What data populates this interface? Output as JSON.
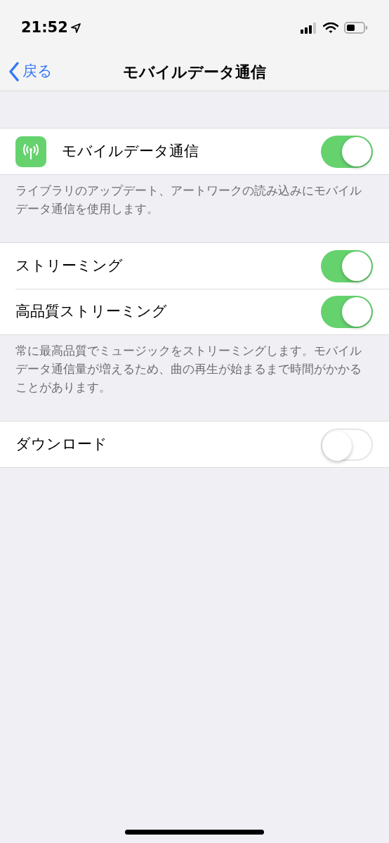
{
  "status_bar": {
    "time": "21:52"
  },
  "nav": {
    "back": "戻る",
    "title": "モバイルデータ通信"
  },
  "groups": [
    {
      "rows": [
        {
          "kind": "icon-toggle",
          "label": "モバイルデータ通信",
          "on": true
        }
      ],
      "footer": "ライブラリのアップデート、アートワークの読み込みにモバイルデータ通信を使用します。"
    },
    {
      "rows": [
        {
          "kind": "toggle",
          "label": "ストリーミング",
          "on": true
        },
        {
          "kind": "toggle",
          "label": "高品質ストリーミング",
          "on": true
        }
      ],
      "footer": "常に最高品質でミュージックをストリーミングします。モバイルデータ通信量が増えるため、曲の再生が始まるまで時間がかかることがあります。"
    },
    {
      "rows": [
        {
          "kind": "toggle",
          "label": "ダウンロード",
          "on": false
        }
      ]
    }
  ]
}
